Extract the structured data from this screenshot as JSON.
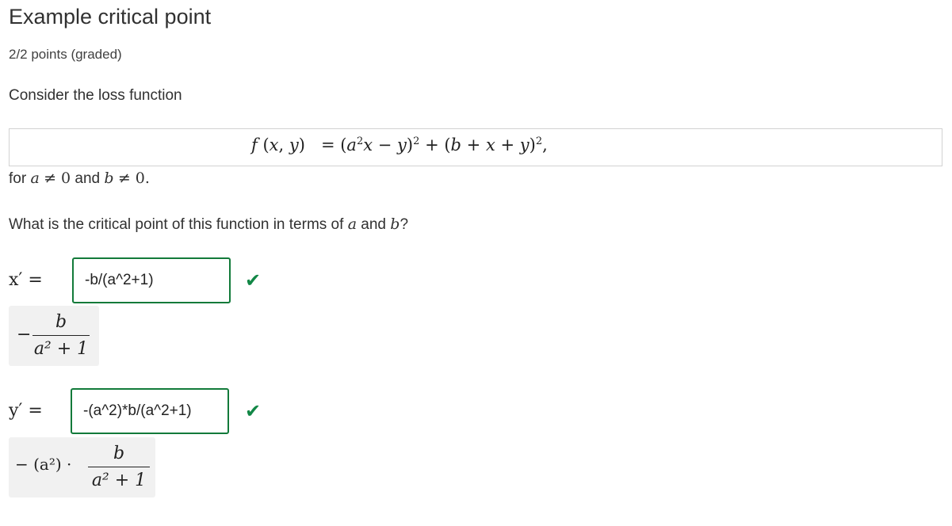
{
  "header": {
    "title": "Example critical point",
    "points": "2/2 points (graded)"
  },
  "problem": {
    "prompt": "Consider the loss function",
    "condition": {
      "prefix": "for ",
      "a_var": "a",
      "neq1": "≠ 0",
      "and_text": " and ",
      "b_var": "b",
      "neq2": "≠ 0."
    },
    "question": {
      "prefix": "What is the critical point of this function in terms of ",
      "a_var": "a",
      "and_text": " and ",
      "b_var": "b",
      "suffix": "?"
    }
  },
  "answers": [
    {
      "label": "x′ =",
      "value": "-b/(a^2+1)",
      "status": "correct",
      "preview": {
        "minus": "−",
        "numerator": "b",
        "denominator": "a² + 1"
      }
    },
    {
      "label": "y′ =",
      "value": "-(a^2)*b/(a^2+1)",
      "status": "correct",
      "preview": {
        "prefix": "− (a²) ·",
        "numerator": "b",
        "denominator": "a² + 1"
      }
    }
  ],
  "icons": {
    "correct": "checkmark-icon"
  },
  "colors": {
    "correct": "#128746",
    "input_border": "#127a3a"
  }
}
